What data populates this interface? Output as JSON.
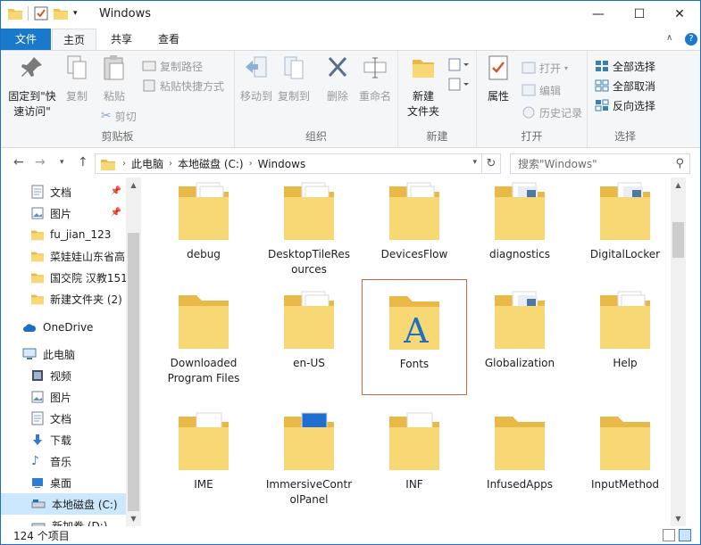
{
  "window": {
    "title": "Windows"
  },
  "ribbon_tabs": [
    "文件",
    "主页",
    "共享",
    "查看"
  ],
  "ribbon": {
    "clipboard": {
      "pin_label_1": "固定到\"快",
      "pin_label_2": "速访问\"",
      "copy": "复制",
      "paste": "粘贴",
      "copy_path": "复制路径",
      "paste_shortcut": "粘贴快捷方式",
      "cut": "剪切",
      "group": "剪贴板"
    },
    "organize": {
      "move_to": "移动到",
      "copy_to": "复制到",
      "delete": "删除",
      "rename": "重命名",
      "group": "组织"
    },
    "new": {
      "new_folder_1": "新建",
      "new_folder_2": "文件夹",
      "group": "新建"
    },
    "open": {
      "properties": "属性",
      "open": "打开",
      "edit": "编辑",
      "history": "历史记录",
      "group": "打开"
    },
    "select": {
      "select_all": "全部选择",
      "select_none": "全部取消",
      "invert": "反向选择",
      "group": "选择"
    }
  },
  "address": {
    "crumbs": [
      "此电脑",
      "本地磁盘 (C:)",
      "Windows"
    ],
    "search_placeholder": "搜索\"Windows\""
  },
  "nav_pane": {
    "quick_access": [
      "文档",
      "图片",
      "fu_jian_123",
      "菜娃娃山东省高",
      "国交院 汉教151",
      "新建文件夹 (2)"
    ],
    "onedrive": "OneDrive",
    "this_pc": "此电脑",
    "pc_items": [
      "视频",
      "图片",
      "文档",
      "下载",
      "音乐",
      "桌面",
      "本地磁盘 (C:)",
      "新加卷 (D:)"
    ]
  },
  "files": [
    {
      "name": "debug"
    },
    {
      "name": "DesktopTileRes\nources"
    },
    {
      "name": "DevicesFlow"
    },
    {
      "name": "diagnostics"
    },
    {
      "name": "DigitalLocker"
    },
    {
      "name": "Downloaded\nProgram Files"
    },
    {
      "name": "en-US"
    },
    {
      "name": "Fonts"
    },
    {
      "name": "Globalization"
    },
    {
      "name": "Help"
    },
    {
      "name": "IME"
    },
    {
      "name": "ImmersiveContr\nolPanel"
    },
    {
      "name": "INF"
    },
    {
      "name": "InfusedApps"
    },
    {
      "name": "InputMethod"
    }
  ],
  "status": {
    "count": "124 个项目"
  },
  "colors": {
    "accent": "#1979ca",
    "selection_border": "#d0663f",
    "folder": "#f8d775",
    "nav_selected": "#cce8ff"
  }
}
